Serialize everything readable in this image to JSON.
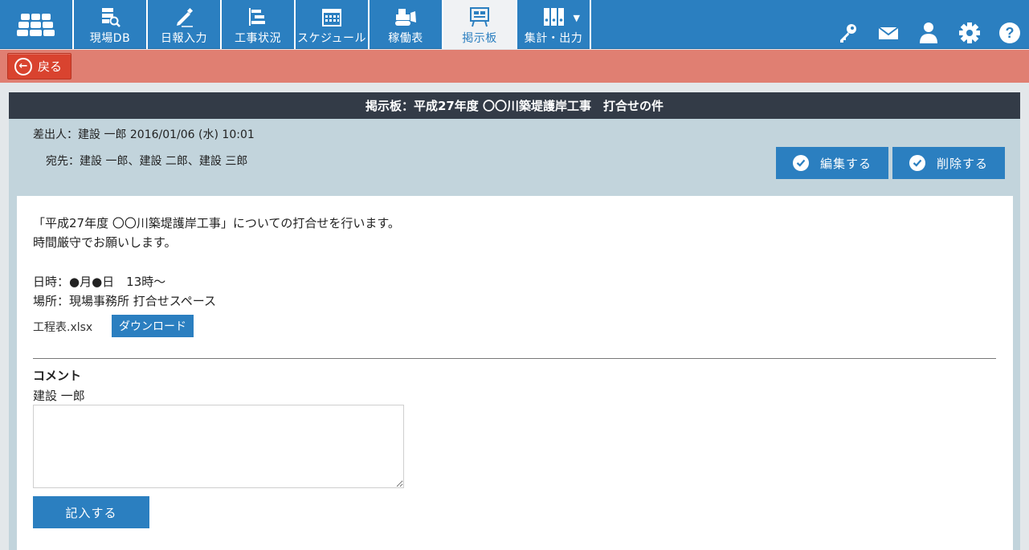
{
  "nav": {
    "items": [
      {
        "label": "現場DB",
        "icon": "db-search-icon"
      },
      {
        "label": "日報入力",
        "icon": "pencil-icon"
      },
      {
        "label": "工事状況",
        "icon": "gantt-icon"
      },
      {
        "label": "スケジュール",
        "icon": "calendar-icon"
      },
      {
        "label": "稼働表",
        "icon": "bulldozer-icon"
      },
      {
        "label": "掲示板",
        "icon": "board-icon"
      },
      {
        "label": "集計・出力",
        "icon": "binders-icon"
      }
    ],
    "active": "掲示板",
    "right_icons": [
      "key-icon",
      "mail-icon",
      "user-icon",
      "gear-icon",
      "help-icon"
    ]
  },
  "back": {
    "label": "戻る"
  },
  "post": {
    "title": "掲示板：平成27年度 〇〇川築堤護岸工事　打合せの件",
    "sender": "差出人：建設 一郎 2016/01/06 (水) 10:01",
    "recipients": "宛先：建設 一郎、建設 二郎、建設 三郎",
    "edit_label": "編集する",
    "delete_label": "削除する",
    "body": [
      "「平成27年度 〇〇川築堤護岸工事」についての打合せを行います。",
      "時間厳守でお願いします。",
      "日時：●月●日　13時～",
      "場所：現場事務所 打合せスペース"
    ],
    "attachment": "工程表.xlsx",
    "download_label": "ダウンロード"
  },
  "comment": {
    "heading": "コメント",
    "user": "建設 一郎",
    "value": "",
    "submit_label": "記入する"
  },
  "colors": {
    "nav_blue": "#2b7fc0",
    "alert_bar": "#e07f72",
    "back_red": "#d9432f",
    "title_dark": "#333b47",
    "meta_bg": "#c2d4dc"
  }
}
